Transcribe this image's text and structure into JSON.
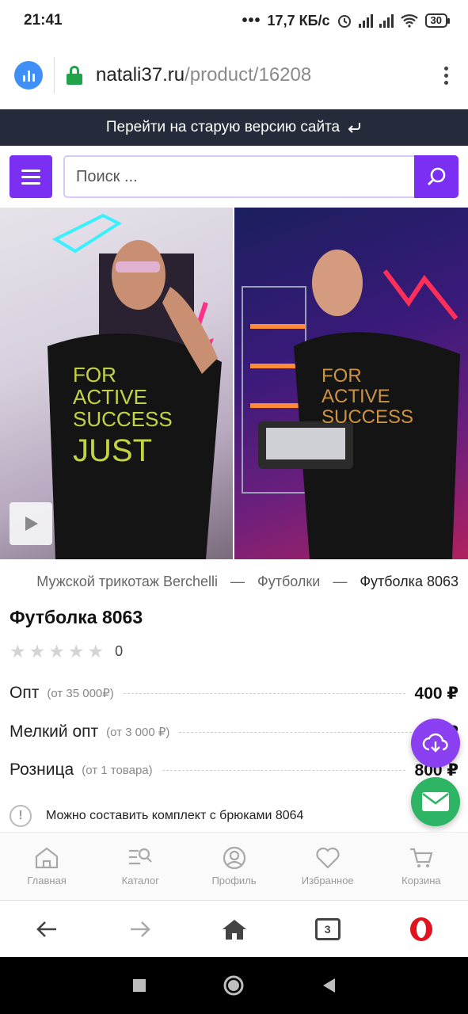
{
  "status_bar": {
    "time": "21:41",
    "dots": "•••",
    "speed": "17,7 КБ/с",
    "battery": "30"
  },
  "browser": {
    "domain": "natali37.ru",
    "path": "/product/16208",
    "tabs_count": "3"
  },
  "banner": {
    "text": "Перейти на старую версию сайта",
    "icon": "return-arrow-icon"
  },
  "search": {
    "placeholder": "Поиск ..."
  },
  "breadcrumb": {
    "items": [
      "Мужской трикотаж Berchelli",
      "—",
      "Футболки",
      "—",
      "Футболка 8063"
    ]
  },
  "product": {
    "title": "Футболка 8063",
    "rating_count": "0",
    "prices": [
      {
        "label": "Опт",
        "min": "(от 35 000₽)",
        "value": "400 ₽"
      },
      {
        "label": "Мелкий опт",
        "min": "(от 3 000 ₽)",
        "value": "4 ₽"
      },
      {
        "label": "Розница",
        "min": "(от 1 товара)",
        "value": "800 ₽"
      }
    ],
    "note": "Можно составить комплект с брюками 8064"
  },
  "site_nav": [
    {
      "label": "Главная",
      "icon": "home-icon"
    },
    {
      "label": "Каталог",
      "icon": "catalog-icon"
    },
    {
      "label": "Профиль",
      "icon": "profile-icon"
    },
    {
      "label": "Избранное",
      "icon": "heart-icon"
    },
    {
      "label": "Корзина",
      "icon": "cart-icon"
    }
  ],
  "colors": {
    "accent": "#7b2ff2",
    "banner": "#252b3a",
    "mail": "#2db565"
  }
}
